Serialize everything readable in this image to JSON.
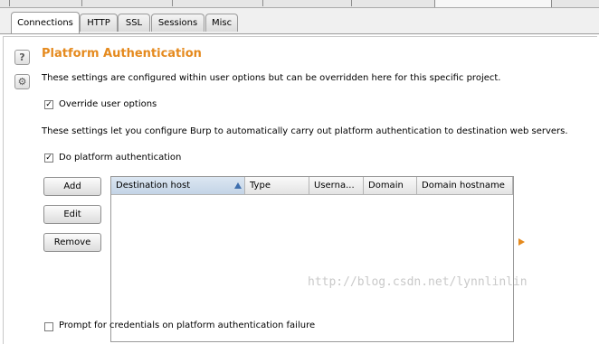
{
  "tabs": [
    {
      "label": "Connections",
      "active": true
    },
    {
      "label": "HTTP",
      "active": false
    },
    {
      "label": "SSL",
      "active": false
    },
    {
      "label": "Sessions",
      "active": false
    },
    {
      "label": "Misc",
      "active": false
    }
  ],
  "icons": {
    "help": {
      "name": "help-icon",
      "glyph": "?"
    },
    "settings": {
      "name": "gear-icon",
      "glyph": "⚙"
    }
  },
  "section": {
    "title": "Platform Authentication",
    "description": "These settings are configured within user options but can be overridden here for this specific project.",
    "override_checkbox": {
      "label": "Override user options",
      "checked": true
    },
    "info_text": "These settings let you configure Burp to automatically carry out platform authentication to destination web servers.",
    "platform_auth_checkbox": {
      "label": "Do platform authentication",
      "checked": true
    },
    "buttons": {
      "add": "Add",
      "edit": "Edit",
      "remove": "Remove"
    },
    "table": {
      "columns": [
        "Destination host",
        "Type",
        "Userna...",
        "Domain",
        "Domain hostname"
      ],
      "sorted_column": "Destination host",
      "sort_direction": "ascending",
      "rows": []
    },
    "prompt_checkbox": {
      "label": "Prompt for credentials on platform authentication failure",
      "checked": false
    }
  },
  "watermark": "http://blog.csdn.net/lynnlinlin",
  "colors": {
    "accent": "#e58a1e",
    "sorted_header": "#c3d4e6"
  }
}
